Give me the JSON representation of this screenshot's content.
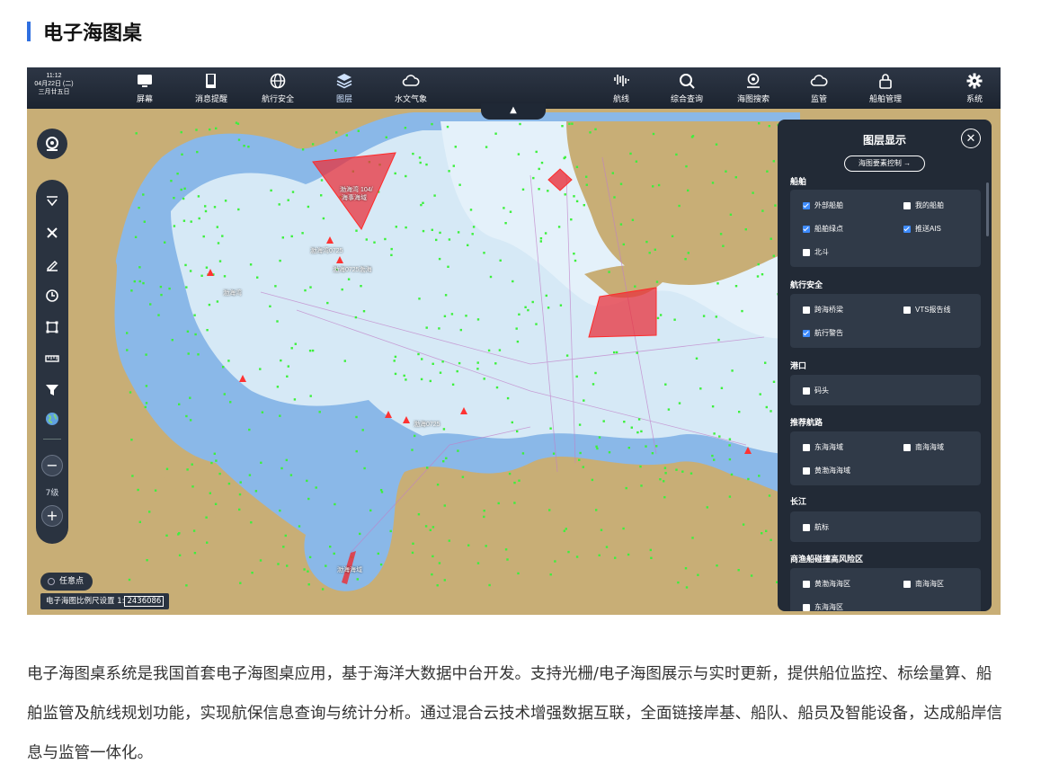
{
  "heading": "电子海图桌",
  "app": {
    "clock": {
      "time": "11:12",
      "date": "04月22日 (二)",
      "lunar": "三月廿五日"
    },
    "nav_left": [
      {
        "label": "屏幕",
        "icon": "monitor-icon"
      },
      {
        "label": "消息提醒",
        "icon": "book-icon"
      },
      {
        "label": "航行安全",
        "icon": "globe-icon"
      },
      {
        "label": "图层",
        "icon": "layers-icon",
        "active": true
      },
      {
        "label": "水文气象",
        "icon": "cloud-icon"
      }
    ],
    "nav_right": [
      {
        "label": "航线",
        "icon": "route-icon"
      },
      {
        "label": "综合查询",
        "icon": "search-icon"
      },
      {
        "label": "海图搜索",
        "icon": "map-pin-icon"
      },
      {
        "label": "监管",
        "icon": "cloud-icon"
      },
      {
        "label": "船舶管理",
        "icon": "lock-icon"
      },
      {
        "label": "系统",
        "icon": "gear-icon"
      }
    ],
    "collapse_symbol": "▲",
    "zoom": {
      "level": "7级",
      "minus": "−",
      "plus": "+"
    },
    "any_point": "任意点",
    "scale": {
      "label": "电子海图比例尺设置 1:",
      "value": "2436086"
    },
    "map_labels": [
      "渤海湾 104/",
      "海事海域",
      "渤海湾0725",
      "渤海0725渤海",
      "渤海湾",
      "渤海0725",
      "渤海海域"
    ],
    "layer_panel": {
      "title": "图层显示",
      "close": "✕",
      "control_button": "海图要素控制 →",
      "sections": [
        {
          "title": "船舶",
          "options": [
            {
              "label": "外部船舶",
              "checked": true
            },
            {
              "label": "我的船舶",
              "checked": false
            },
            {
              "label": "船舶绿点",
              "checked": true
            },
            {
              "label": "推送AIS",
              "checked": true
            },
            {
              "label": "北斗",
              "checked": false
            }
          ]
        },
        {
          "title": "航行安全",
          "options": [
            {
              "label": "跨海桥梁",
              "checked": false
            },
            {
              "label": "VTS报告线",
              "checked": false
            },
            {
              "label": "航行警告",
              "checked": true
            }
          ]
        },
        {
          "title": "港口",
          "options": [
            {
              "label": "码头",
              "checked": false
            }
          ]
        },
        {
          "title": "推荐航路",
          "options": [
            {
              "label": "东海海域",
              "checked": false
            },
            {
              "label": "南海海域",
              "checked": false
            },
            {
              "label": "黄渤海海域",
              "checked": false
            }
          ]
        },
        {
          "title": "长江",
          "options": [
            {
              "label": "航标",
              "checked": false
            }
          ]
        },
        {
          "title": "商渔船碰撞高风险区",
          "options": [
            {
              "label": "黄渤海海区",
              "checked": false
            },
            {
              "label": "南海海区",
              "checked": false
            },
            {
              "label": "东海海区",
              "checked": false
            }
          ]
        }
      ]
    }
  },
  "description": "电子海图桌系统是我国首套电子海图桌应用，基于海洋大数据中台开发。支持光栅/电子海图展示与实时更新，提供船位监控、标绘量算、船舶监管及航线规划功能，实现航保信息查询与统计分析。通过混合云技术增强数据互联，全面链接岸基、船队、船员及智能设备，达成船岸信息与监管一体化。",
  "colors": {
    "accent": "#2f6fe0",
    "panel": "#222a36",
    "warning_area": "#e8323c",
    "ship": "#3cf03c"
  }
}
